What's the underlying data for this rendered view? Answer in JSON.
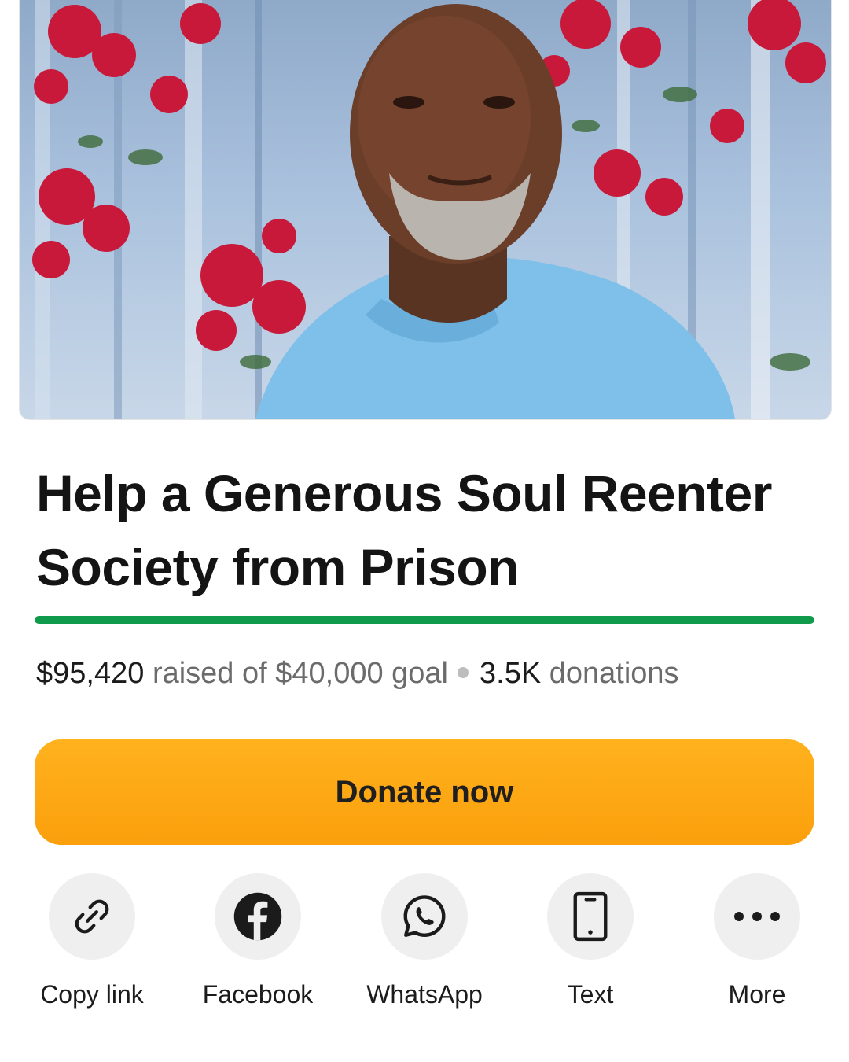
{
  "campaign": {
    "title": "Help a Generous Soul Reenter Society from Prison",
    "raised": "$95,420",
    "raised_suffix": "raised of $40,000 goal",
    "donation_count": "3.5K",
    "donation_suffix": "donations",
    "progress_fraction": 1.0
  },
  "donate_label": "Donate now",
  "share": {
    "items": [
      {
        "label": "Copy link",
        "icon": "link-icon"
      },
      {
        "label": "Facebook",
        "icon": "facebook-icon"
      },
      {
        "label": "WhatsApp",
        "icon": "whatsapp-icon"
      },
      {
        "label": "Text",
        "icon": "phone-icon"
      },
      {
        "label": "More",
        "icon": "more-icon"
      }
    ]
  },
  "colors": {
    "progress": "#109a4b",
    "donate": "#fca712",
    "icon_bg": "#efefef"
  }
}
